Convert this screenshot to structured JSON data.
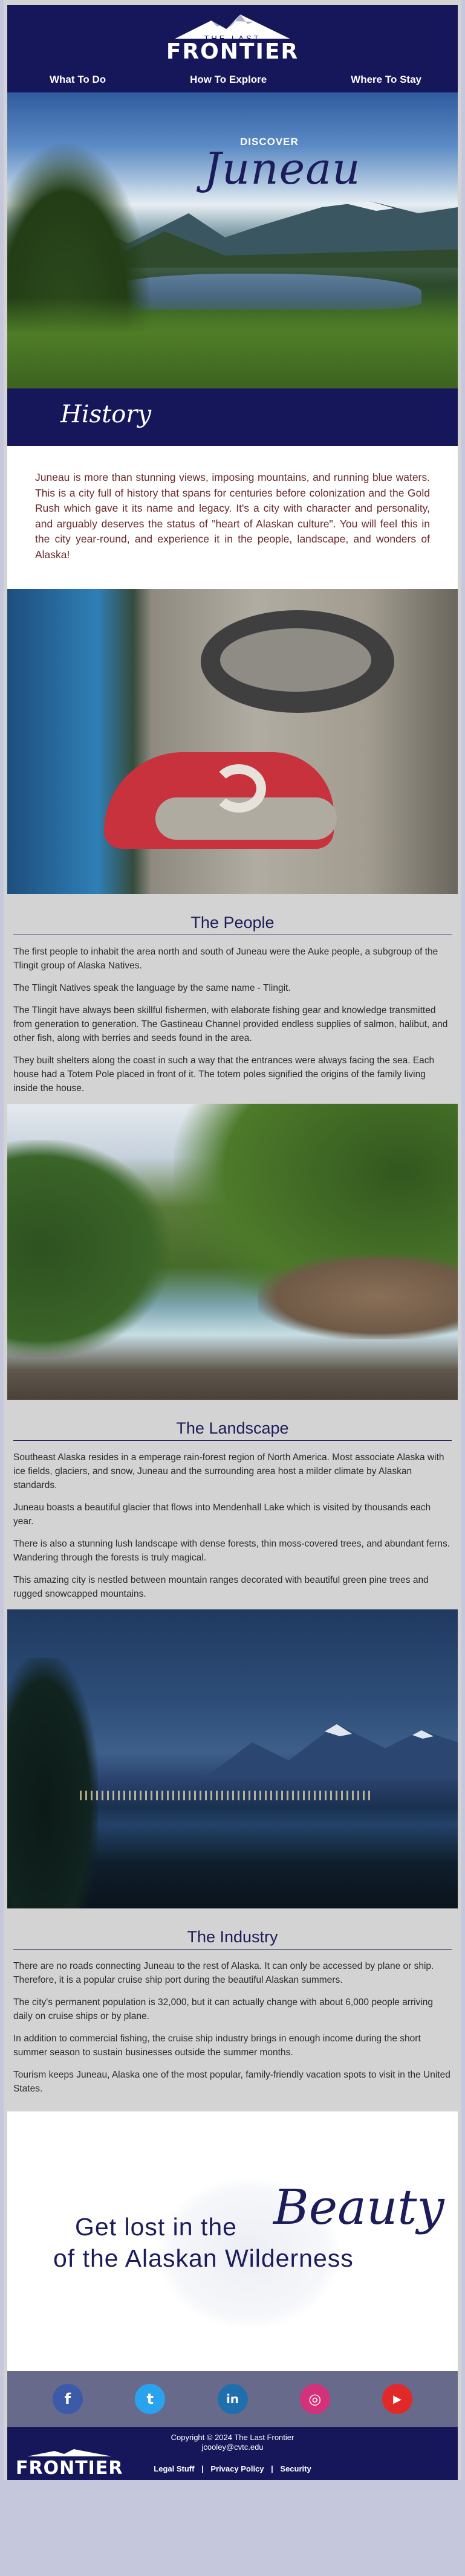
{
  "brand": {
    "the_last": "THE LAST",
    "frontier": "FRONTIER"
  },
  "nav": {
    "items": [
      "What To Do",
      "How To Explore",
      "Where To Stay"
    ]
  },
  "hero": {
    "discover": "DISCOVER",
    "city": "Juneau"
  },
  "history": {
    "title": "History",
    "body": "Juneau is more than stunning views, imposing mountains, and running blue waters. This is a city full of history that spans for centuries before colonization and the Gold Rush which gave it its name and legacy. It's a city with character and personality, and arguably deserves the status of \"heart of Alaskan culture\". You will feel this in the city year-round, and experience it in the people, landscape, and wonders of Alaska!"
  },
  "people": {
    "title": "The People",
    "paragraphs": [
      "The first people to inhabit the area north and south of Juneau were the Auke people, a subgroup of the Tlingit group of Alaska Natives.",
      "The Tlingit Natives speak the language by the same name - Tlingit.",
      "The Tlingit have always been skillful fishermen, with elaborate fishing gear and knowledge transmitted from generation to generation. The Gastineau Channel provided endless supplies of salmon, halibut, and other fish, along with berries and seeds found in the area.",
      "They built shelters along the coast in such a way that the entrances were always facing the sea. Each house had a Totem Pole placed in front of it. The totem poles signified the origins of the family living inside the house."
    ]
  },
  "landscape": {
    "title": "The Landscape",
    "paragraphs": [
      "Southeast Alaska resides in a emperage rain-forest region of North America. Most associate Alaska with ice fields, glaciers, and snow, Juneau and the surrounding area host a milder climate by Alaskan standards.",
      "Juneau boasts a beautiful glacier that flows into Mendenhall Lake which is visited by thousands each year.",
      "There is also a stunning lush landscape with dense forests, thin moss-covered trees, and abundant ferns. Wandering through the forests is truly magical.",
      "This amazing city is nestled between mountain ranges decorated with beautiful green pine trees and rugged snowcapped mountains."
    ]
  },
  "industry": {
    "title": "The Industry",
    "paragraphs": [
      "There are no roads connecting Juneau to the rest of Alaska. It can only be accessed by plane or ship. Therefore, it is a popular cruise ship port during the beautiful Alaskan summers.",
      "The city's permanent population is 32,000, but it can actually change with about 6,000 people arriving daily on cruise ships or by plane.",
      "In addition to commercial fishing, the cruise ship industry brings in enough income during the short summer season to sustain businesses outside the summer months.",
      "Tourism keeps Juneau, Alaska one of the most popular, family-friendly vacation spots to visit in the United States."
    ]
  },
  "cta": {
    "line1": "Get lost in the",
    "beauty": "Beauty",
    "line2": "of the Alaskan Wilderness"
  },
  "social": [
    {
      "icon": "facebook-icon",
      "glyph": "f",
      "color": "#3b5aa8"
    },
    {
      "icon": "twitter-icon",
      "glyph": "t",
      "color": "#2aa3ef"
    },
    {
      "icon": "linkedin-icon",
      "glyph": "in",
      "color": "#1f6fae"
    },
    {
      "icon": "instagram-icon",
      "glyph": "◎",
      "color": "#d3327a"
    },
    {
      "icon": "youtube-icon",
      "glyph": "▶",
      "color": "#e02a2a"
    }
  ],
  "footer": {
    "copyright": "Copyright © 2024 The Last Frontier",
    "email": "jcooley@cvtc.edu",
    "logo": "FRONTIER",
    "logo_small": "THE LAST",
    "links": [
      "Legal Stuff",
      "Privacy Policy",
      "Security"
    ],
    "separator": "|"
  },
  "colors": {
    "navy": "#16165a",
    "page_bg": "#d3d3d3",
    "social_bar": "#686a8b"
  }
}
